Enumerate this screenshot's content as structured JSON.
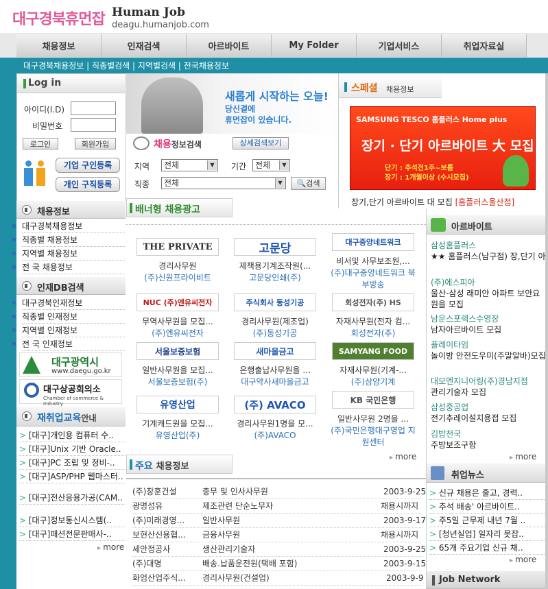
{
  "header": {
    "logo": "대구경북휴먼잡",
    "brand": "Human Job",
    "url": "deagu.humanjob.com"
  },
  "nav": [
    "채용정보",
    "인재검색",
    "아르바이트",
    "My Folder",
    "기업서비스",
    "취업자료실"
  ],
  "subnav": "대구경북채용정보 | 직종별검색 | 지역별검색 | 전국채용정보",
  "login": {
    "title": "Log in",
    "id_label": "아이디(I.D)",
    "pw_label": "비밀번호",
    "login_btn": "로그인",
    "join_btn": "회원가입",
    "company_btn": "기업 구인등록",
    "person_btn": "개인 구직등록"
  },
  "jobinfo": {
    "title": "채용정보",
    "items": [
      "대구경북채용정보",
      "직종별 채용정보",
      "지역별 채용정보",
      "전 국 채용정보"
    ]
  },
  "talent": {
    "title": "인재DB검색",
    "items": [
      "대구경북인재정보",
      "직종별 인재정보",
      "지역별 인재정보",
      "전 국 인재정보"
    ]
  },
  "banners": {
    "daegu": "대구광역시",
    "daegu_url": "www.daegu.go.kr",
    "chamber": "대구상공회의소",
    "chamber_en": "Chamber of commerce & Industry"
  },
  "edu": {
    "title": "재취업교육",
    "suffix": "안내",
    "items": [
      "[대구]개인용 컴퓨터 수..",
      "[대구]Unix 기반 Oracle..",
      "[대구]PC 조립 및 정비-..",
      "[대구]ASP/PHP 웹마스터..",
      "[대구]전산응용가공(CAM..",
      "[대구]정보통신시스템(..",
      "[대구]패션전문판매사-.."
    ],
    "more": "more"
  },
  "hero": {
    "line1": "새롭게 시작하는 오늘!",
    "line2": "당신곁에",
    "line3": "휴먼잡이 있습니다."
  },
  "search": {
    "title": "채용",
    "title2": "정보검색",
    "detail_btn": "상세검색보기",
    "region_label": "지역",
    "region_val": "전체",
    "period_label": "기간",
    "period_val": "전체",
    "job_label": "직종",
    "job_val": "전체",
    "search_btn": "검색"
  },
  "special": {
    "title": "스페셜",
    "sub": "채용정보",
    "brand": "SAMSUNG TESCO 홈플러스 Home plus",
    "headline": "장기 · 단기 아르바이트 大 모집",
    "d1": "단기 : 추석전1주~보름",
    "d2": "장기 : 1개월이상 (수시모집)",
    "caption": "장기,단기 아르바이트 대 모집",
    "caption_link": "[홈플러스울산점]"
  },
  "banner_ads": {
    "title": "배너형 채용광고",
    "more": "more",
    "cards": [
      {
        "logo": "THE PRIVATE",
        "d1": "경리사무원",
        "d2": "(주)신원프라이비트"
      },
      {
        "logo": "고문당",
        "d1": "제책용기계조작원(...",
        "d2": "고문당인쇄(주)"
      },
      {
        "logo": "대구중앙네트워크",
        "d1": "비서및 사무보조원,...",
        "d2": "(주)대구중앙네트워크 북부방송"
      },
      {
        "logo": "NUC (주)엔유씨전자",
        "d1": "무역사무원을 모집...",
        "d2": "(주)엔유씨전자"
      },
      {
        "logo": "주식회사 동성기공",
        "d1": "경리사무원(제조업)",
        "d2": "(주)동성기공"
      },
      {
        "logo": "회성전자(주) HS",
        "d1": "자재사무원(전자 컴...",
        "d2": "회성전자(주)"
      },
      {
        "logo": "서울보증보험",
        "d1": "일반사무원을 모집...",
        "d2": "서울보증보험(주)"
      },
      {
        "logo": "새마을금고",
        "d1": "은행출납사무원을 ...",
        "d2": "대구약사새마을금고"
      },
      {
        "logo": "SAMYANG FOOD",
        "d1": "자재사무원(기계-...",
        "d2": "(주)삼양기계"
      },
      {
        "logo": "유영산업",
        "d1": "기계캐드원을 모집...",
        "d2": "유영산업(주)"
      },
      {
        "logo": "(주) AVACO",
        "d1": "경리사무원1명을 모...",
        "d2": "(주)AVACO"
      },
      {
        "logo": "KB 국민은행",
        "d1": "일반사무원 2명을 ...",
        "d2": "(주)국민은행대구영업 지원센터"
      }
    ]
  },
  "main_jobs": {
    "title": "주요",
    "title2": "채용정보",
    "rows": [
      {
        "c": "(주)창훈건설",
        "j": "총무 및 인사사무원",
        "d": "2003-9-25"
      },
      {
        "c": "광명섬유",
        "j": "제조관련 단순노무자",
        "d": "채용시까지"
      },
      {
        "c": "(주)미래경영...",
        "j": "일반사무원",
        "d": "2003-9-17"
      },
      {
        "c": "보현산신용협...",
        "j": "금융사무원",
        "d": "채용시까지"
      },
      {
        "c": "세안정공사",
        "j": "생산관리기술자",
        "d": "2003-9-25"
      },
      {
        "c": "(주)대명",
        "j": "배송.납품운전원(택배 포함)",
        "d": "2003-9-15"
      },
      {
        "c": "화엄산업주식...",
        "j": "경리사무원(건설업)",
        "d": "2003-9-9"
      }
    ]
  },
  "albait": {
    "title": "아르바이트",
    "items": [
      {
        "t": "삼성홈플러스",
        "s": "★★ 홈플러스(남구점) 장,단기 아르..."
      },
      {
        "t": "(주)에스피아",
        "s": "울산-삼성 래미안 아파트 보안요원을 모집"
      },
      {
        "t": "남운스포렉스수영장",
        "s": "남자아르바이트 모집"
      },
      {
        "t": "플레이타임",
        "s": "놀이방 안전도우미(주말알바)모집"
      },
      {
        "t": "대모엔지니어링(주)경남지점",
        "s": "관리기술자 모집"
      },
      {
        "t": "삼성중공업",
        "s": "전기추레이설치용접 모집"
      },
      {
        "t": "김밥천국",
        "s": "주방보조구함"
      }
    ],
    "more": "more"
  },
  "news": {
    "title": "취업뉴스",
    "items": [
      "신규 채용은 줄고, 경력..",
      "추석 배송' 아르바이트..",
      "주5일 근무제 내년 7월 ..",
      "[청년실업] 일자리 못잡..",
      "65개 주요기업 신규 채.."
    ],
    "more": "more"
  },
  "jobnetwork": {
    "title": "Job Network"
  }
}
